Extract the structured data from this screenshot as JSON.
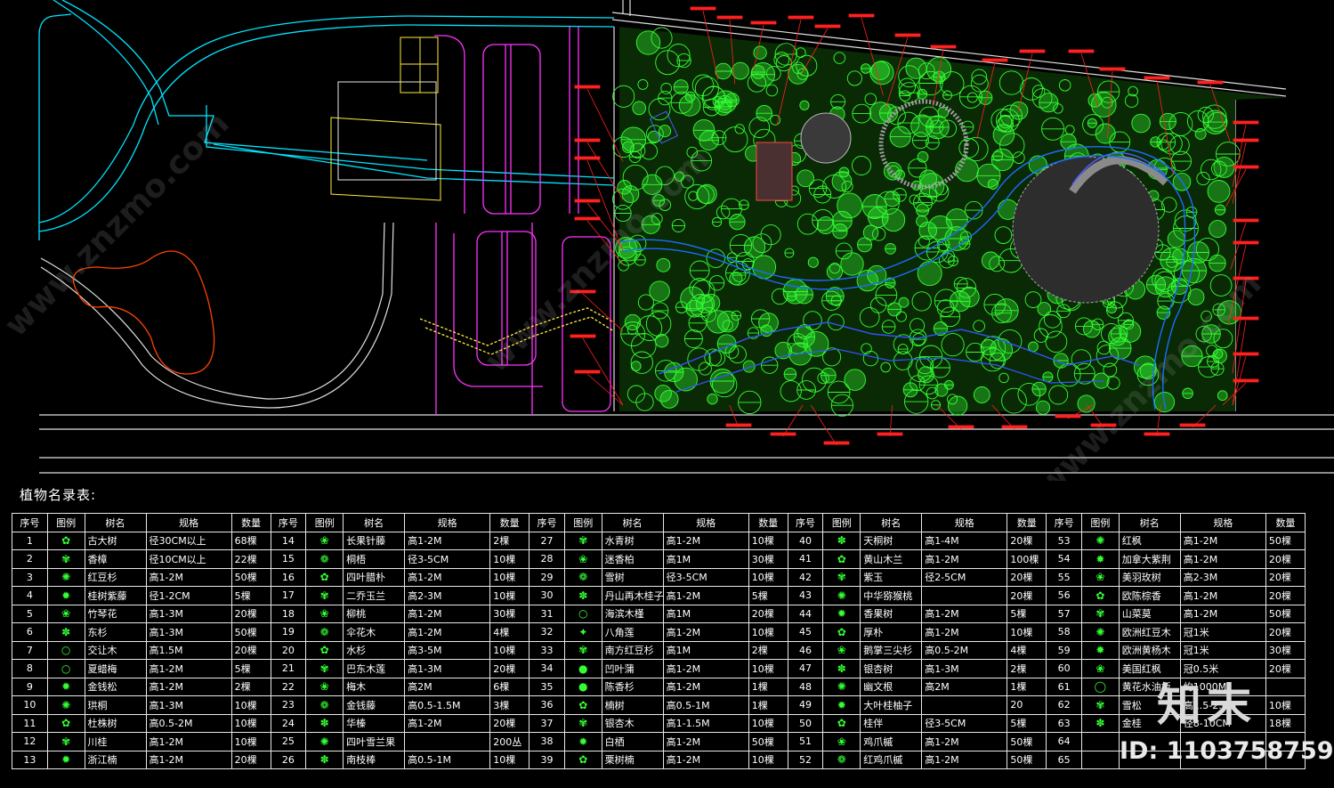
{
  "legend_title": "植物名录表:",
  "table_headers": [
    "序号",
    "图例",
    "树名",
    "规格",
    "数量",
    "序号",
    "图例",
    "树名",
    "规格",
    "数量",
    "序号",
    "图例",
    "树名",
    "规格",
    "数量",
    "序号",
    "图例",
    "树名",
    "规格",
    "数量",
    "序号",
    "图例",
    "树名",
    "规格",
    "数量"
  ],
  "rows": [
    [
      "1",
      "✿",
      "古大树",
      "径30CM以上",
      "68棵",
      "14",
      "❀",
      "长果针藤",
      "高1-2M",
      "2棵",
      "27",
      "✾",
      "水青树",
      "高1-2M",
      "10棵",
      "40",
      "✽",
      "天桐树",
      "高1-4M",
      "20棵",
      "53",
      "✺",
      "红枫",
      "高1-2M",
      "50棵"
    ],
    [
      "2",
      "✾",
      "香樟",
      "径10CM以上",
      "22棵",
      "15",
      "❁",
      "桐梧",
      "径3-5CM",
      "10棵",
      "28",
      "❀",
      "迷香柏",
      "高1M",
      "30棵",
      "41",
      "✿",
      "黄山木兰",
      "高1-2M",
      "100棵",
      "54",
      "✹",
      "加拿大紫荆",
      "高1-2M",
      "20棵"
    ],
    [
      "3",
      "✺",
      "红豆杉",
      "高1-2M",
      "50棵",
      "16",
      "✿",
      "四叶腊朴",
      "高1-2M",
      "10棵",
      "29",
      "❁",
      "雪树",
      "径3-5CM",
      "10棵",
      "42",
      "✾",
      "紫玉",
      "径2-5CM",
      "20棵",
      "55",
      "❀",
      "美羽玫树",
      "高2-3M",
      "20棵"
    ],
    [
      "4",
      "✹",
      "桂树紫藤",
      "径1-2CM",
      "5棵",
      "17",
      "✾",
      "二乔玉兰",
      "高2-3M",
      "10棵",
      "30",
      "✽",
      "丹山再木桂子",
      "高1-2M",
      "5棵",
      "43",
      "✺",
      "中华猕猴桃",
      "",
      "20棵",
      "56",
      "✿",
      "欧陈棕香",
      "高1-2M",
      "20棵"
    ],
    [
      "5",
      "❀",
      "竹琴花",
      "高1-3M",
      "20棵",
      "18",
      "❀",
      "柳桃",
      "高1-2M",
      "30棵",
      "31",
      "○",
      "海滨木槿",
      "高1M",
      "20棵",
      "44",
      "✹",
      "香果树",
      "高1-2M",
      "5棵",
      "57",
      "✾",
      "山菜莫",
      "高1-2M",
      "50棵"
    ],
    [
      "6",
      "✽",
      "东杉",
      "高1-3M",
      "50棵",
      "19",
      "❁",
      "伞花木",
      "高1-2M",
      "4棵",
      "32",
      "✦",
      "八角莲",
      "高1-2M",
      "10棵",
      "45",
      "✿",
      "厚朴",
      "高1-2M",
      "10棵",
      "58",
      "✺",
      "欧洲红豆木",
      "冠1米",
      "20棵"
    ],
    [
      "7",
      "○",
      "交让木",
      "高1.5M",
      "20棵",
      "20",
      "✿",
      "水杉",
      "高3-5M",
      "10棵",
      "33",
      "✾",
      "南方红豆杉",
      "高1M",
      "2棵",
      "46",
      "❀",
      "鹅掌三尖杉",
      "高0.5-2M",
      "4棵",
      "59",
      "✹",
      "欧洲黄杨木",
      "冠1米",
      "30棵"
    ],
    [
      "8",
      "○",
      "夏蜡梅",
      "高1-2M",
      "5棵",
      "21",
      "✾",
      "巴东木莲",
      "高1-3M",
      "20棵",
      "34",
      "●",
      "凹叶蒲",
      "高1-2M",
      "10棵",
      "47",
      "✽",
      "银杏树",
      "高1-3M",
      "2棵",
      "60",
      "❀",
      "美国红枫",
      "冠0.5米",
      "20棵"
    ],
    [
      "9",
      "✹",
      "金钱松",
      "高1-2M",
      "2棵",
      "22",
      "❀",
      "梅木",
      "高2M",
      "6棵",
      "35",
      "●",
      "陈香杉",
      "高1-2M",
      "1棵",
      "48",
      "✺",
      "幽文根",
      "高2M",
      "1棵",
      "61",
      "◯",
      "黄花水油板",
      "约1000M²",
      ""
    ],
    [
      "10",
      "✺",
      "珙桐",
      "高1-3M",
      "10棵",
      "23",
      "❁",
      "金钱藤",
      "高0.5-1.5M",
      "3棵",
      "36",
      "✿",
      "楠树",
      "高0.5-1M",
      "1棵",
      "49",
      "✹",
      "大叶桂柚子",
      "",
      "20",
      "62",
      "✾",
      "雪松",
      "高1.5-2.0M",
      "10棵"
    ],
    [
      "11",
      "✿",
      "杜株树",
      "高0.5-2M",
      "10棵",
      "24",
      "✽",
      "华榛",
      "高1-2M",
      "20棵",
      "37",
      "✾",
      "银杏木",
      "高1-1.5M",
      "10棵",
      "50",
      "✿",
      "桂伴",
      "径3-5CM",
      "5棵",
      "63",
      "✽",
      "金桂",
      "径8-10CM",
      "18棵"
    ],
    [
      "12",
      "✾",
      "川桂",
      "高1-2M",
      "10棵",
      "25",
      "✺",
      "四叶雪兰果",
      "",
      "200丛",
      "38",
      "✹",
      "白栖",
      "高1-2M",
      "50棵",
      "51",
      "❀",
      "鸡爪槭",
      "高1-2M",
      "50棵",
      "64",
      "",
      "",
      "",
      ""
    ],
    [
      "13",
      "✹",
      "浙江楠",
      "高1-2M",
      "20棵",
      "26",
      "✽",
      "南枝棒",
      "高0.5-1M",
      "10棵",
      "39",
      "✿",
      "栗树楠",
      "高1-2M",
      "10棵",
      "52",
      "❁",
      "红鸡爪槭",
      "高1-2M",
      "50棵",
      "65",
      "",
      "",
      "",
      ""
    ]
  ],
  "watermark": {
    "logo": "知末",
    "id": "ID: 1103758759",
    "site": "www.znzmo.com"
  },
  "colors": {
    "background": "#000000",
    "trees": "#33ff33",
    "labels": "#ff2020",
    "roads": "#ff33ff",
    "paths": "#00ffff",
    "pond": "#ff4400",
    "grid": "#e8e8e8"
  }
}
